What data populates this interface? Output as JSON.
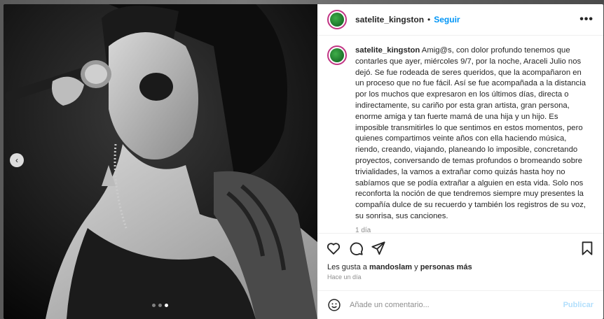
{
  "post": {
    "username": "satelite_kingston",
    "follow_label": "Seguir",
    "separator": "•",
    "more_label": "•••",
    "caption_user": "satelite_kingston",
    "caption_text": " Amig@s, con dolor profundo tenemos que contarles que ayer, miércoles 9/7, por la noche, Araceli Julio nos dejó. Se fue rodeada de seres queridos, que la acompañaron en un proceso que no fue fácil. Así se fue acompañada a la distancia por los muchos que expresaron en los últimos días, directa o indirectamente, su cariño por esta gran artista, gran persona, enorme amiga y tan fuerte mamá de una hija y un hijo. Es imposible transmitirles lo que sentimos en estos momentos, pero quienes compartimos veinte años con ella haciendo música, riendo, creando, viajando, planeando lo imposible, concretando proyectos, conversando de temas profundos o bromeando sobre trivialidades, la vamos a extrañar como quizás hasta hoy no sabíamos que se podía extrañar a alguien en esta vida. Solo nos reconforta la noción de que tendremos siempre muy presentes la compañía dulce de su recuerdo y también los registros de su voz, su sonrisa, sus canciones.",
    "caption_time": "1 día",
    "likes_prefix": "Les gusta a ",
    "likes_user": "mandoslam",
    "likes_join": " y ",
    "likes_others": "personas más",
    "posted_ago": "Hace un día"
  },
  "carousel": {
    "prev_label": "‹",
    "slide_count": 3,
    "active_index": 2
  },
  "comment": {
    "placeholder": "Añade un comentario...",
    "publish_label": "Publicar"
  },
  "icons": {
    "like": "heart-icon",
    "comment": "comment-icon",
    "share": "share-icon",
    "save": "bookmark-icon",
    "emoji": "emoji-icon"
  },
  "colors": {
    "accent": "#0095f6",
    "publish_disabled": "#b2dffc",
    "muted": "#8e8e8e",
    "text": "#262626"
  }
}
